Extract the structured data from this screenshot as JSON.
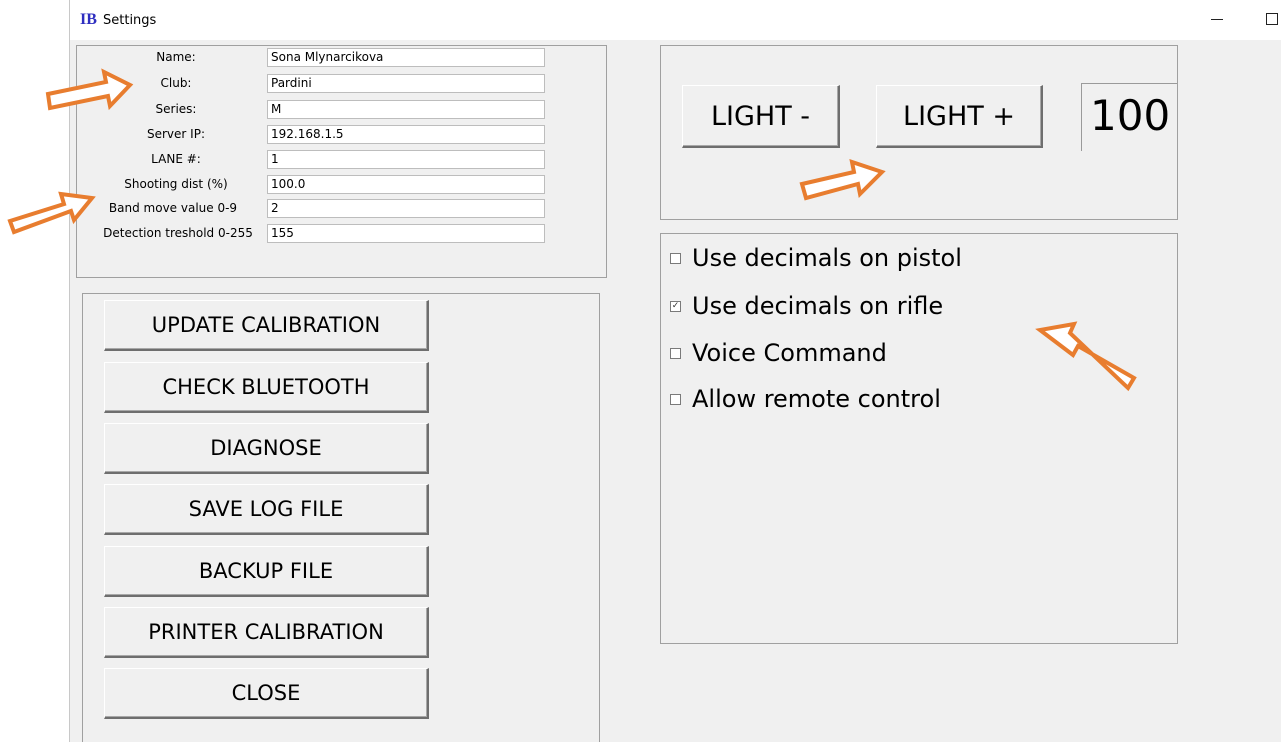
{
  "window": {
    "logo_text": "IB",
    "title": "Settings",
    "controls": [
      "minimize-icon",
      "maximize-icon"
    ]
  },
  "fields": [
    {
      "label": "Name:",
      "value": "Sona Mlynarcikova"
    },
    {
      "label": "Club:",
      "value": "Pardini"
    },
    {
      "label": "Series:",
      "value": "M"
    },
    {
      "label": "Server IP:",
      "value": "192.168.1.5"
    },
    {
      "label": "LANE #:",
      "value": "1"
    },
    {
      "label": "Shooting dist (%)",
      "value": "100.0"
    },
    {
      "label": "Band move value 0-9",
      "value": "2"
    },
    {
      "label": "Detection treshold 0-255",
      "value": "155"
    }
  ],
  "actions": [
    "UPDATE CALIBRATION",
    "CHECK BLUETOOTH",
    "DIAGNOSE",
    "SAVE LOG FILE",
    "BACKUP FILE",
    "PRINTER CALIBRATION",
    "CLOSE"
  ],
  "light": {
    "minus_label": "LIGHT -",
    "plus_label": "LIGHT +",
    "value": "100"
  },
  "options": [
    {
      "label": "Use decimals on pistol",
      "checked": false
    },
    {
      "label": "Use decimals on rifle",
      "checked": true
    },
    {
      "label": "Voice Command",
      "checked": false
    },
    {
      "label": "Allow remote control",
      "checked": false
    }
  ],
  "annotation_color": "#e87d2f"
}
